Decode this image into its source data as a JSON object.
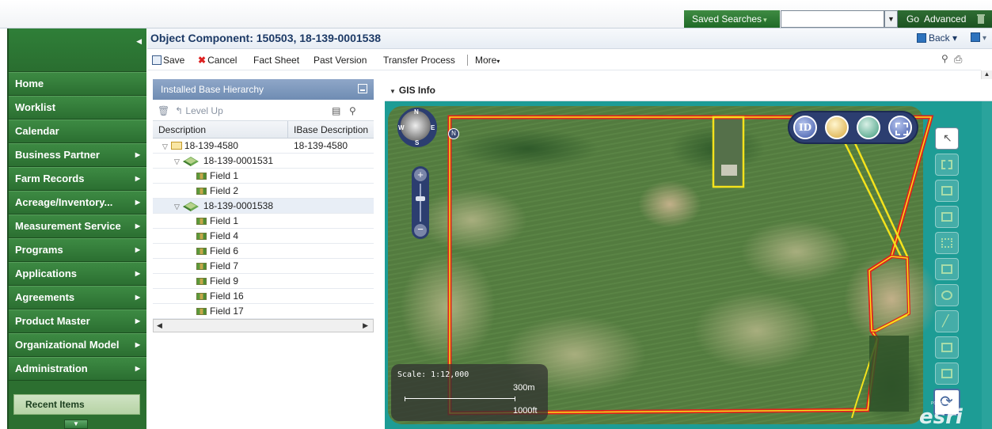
{
  "topbar": {
    "saved_searches": "Saved Searches",
    "search_value": "",
    "go": "Go",
    "advanced": "Advanced"
  },
  "nav": {
    "items": [
      {
        "label": "Home",
        "has_arrow": false
      },
      {
        "label": "Worklist",
        "has_arrow": false
      },
      {
        "label": "Calendar",
        "has_arrow": false
      },
      {
        "label": "Business Partner",
        "has_arrow": true
      },
      {
        "label": "Farm Records",
        "has_arrow": true
      },
      {
        "label": "Acreage/Inventory...",
        "has_arrow": true
      },
      {
        "label": "Measurement Service",
        "has_arrow": true
      },
      {
        "label": "Programs",
        "has_arrow": true
      },
      {
        "label": "Applications",
        "has_arrow": true
      },
      {
        "label": "Agreements",
        "has_arrow": true
      },
      {
        "label": "Product Master",
        "has_arrow": true
      },
      {
        "label": "Organizational Model",
        "has_arrow": true
      },
      {
        "label": "Administration",
        "has_arrow": true
      }
    ],
    "recent_items": "Recent Items"
  },
  "header": {
    "title": "Object Component: 150503, 18-139-0001538",
    "back": "Back"
  },
  "toolbar": {
    "save": "Save",
    "cancel": "Cancel",
    "fact_sheet": "Fact Sheet",
    "past_version": "Past Version",
    "transfer_process": "Transfer Process",
    "more": "More"
  },
  "hierarchy": {
    "title": "Installed Base Hierarchy",
    "level_up": "Level Up",
    "col_description": "Description",
    "col_ibase": "IBase Description",
    "rows": [
      {
        "label": "18-139-4580",
        "ibase": "18-139-4580",
        "level": 0,
        "kind": "folder",
        "expanded": true
      },
      {
        "label": "18-139-0001531",
        "ibase": "",
        "level": 1,
        "kind": "land",
        "expanded": true
      },
      {
        "label": "Field 1",
        "ibase": "",
        "level": 2,
        "kind": "field"
      },
      {
        "label": "Field 2",
        "ibase": "",
        "level": 2,
        "kind": "field"
      },
      {
        "label": "18-139-0001538",
        "ibase": "",
        "level": 1,
        "kind": "land",
        "expanded": true,
        "selected": true
      },
      {
        "label": "Field 1",
        "ibase": "",
        "level": 2,
        "kind": "field"
      },
      {
        "label": "Field 4",
        "ibase": "",
        "level": 2,
        "kind": "field"
      },
      {
        "label": "Field 6",
        "ibase": "",
        "level": 2,
        "kind": "field"
      },
      {
        "label": "Field 7",
        "ibase": "",
        "level": 2,
        "kind": "field"
      },
      {
        "label": "Field 9",
        "ibase": "",
        "level": 2,
        "kind": "field"
      },
      {
        "label": "Field 16",
        "ibase": "",
        "level": 2,
        "kind": "field"
      },
      {
        "label": "Field 17",
        "ibase": "",
        "level": 2,
        "kind": "field"
      }
    ]
  },
  "gis": {
    "title": "GIS Info",
    "scale_label": "Scale: 1:12,000",
    "scale_metric": "300m",
    "scale_imperial": "1000ft",
    "compass_n": "N",
    "compass_s": "S",
    "compass_e": "E",
    "compass_w": "W",
    "north_button": "N",
    "id_button": "ID",
    "powered_by": "POWERED BY",
    "brand": "esri"
  },
  "colors": {
    "nav_green": "#2c6f30",
    "boundary_red": "#e0221b",
    "boundary_yellow": "#f4e21c",
    "panel_blue": "#7e99be"
  }
}
